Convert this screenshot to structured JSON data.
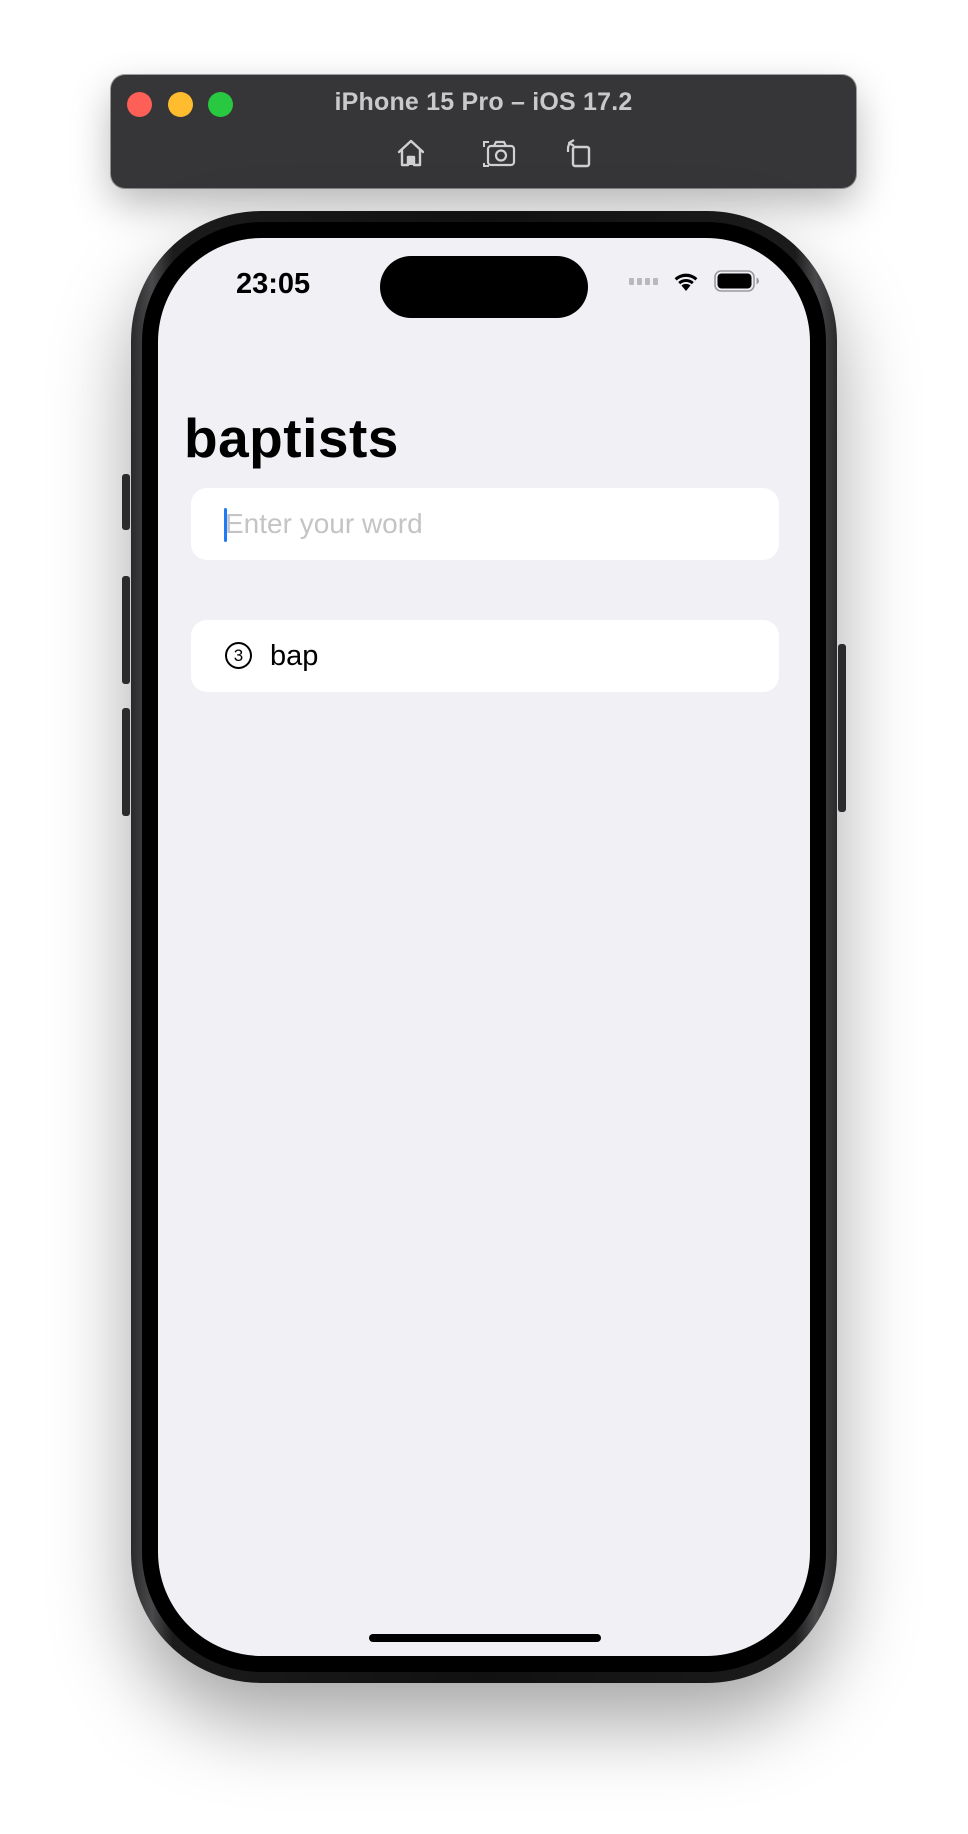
{
  "simulator": {
    "title": "iPhone 15 Pro – iOS 17.2",
    "buttons": [
      "home-icon",
      "screenshot-icon",
      "rotate-icon"
    ],
    "traffic_light_colors": [
      "#fe5f57",
      "#febc2e",
      "#28c840"
    ]
  },
  "status_bar": {
    "time": "23:05"
  },
  "nav": {
    "title": "baptists"
  },
  "search": {
    "value": "",
    "placeholder": "Enter your word"
  },
  "results": [
    {
      "count": "3",
      "word": "bap"
    }
  ],
  "colors": {
    "screen_background": "#f1f0f5",
    "card_background": "#ffffff",
    "cursor": "#1e7bf5",
    "toolbar": "#363638"
  }
}
